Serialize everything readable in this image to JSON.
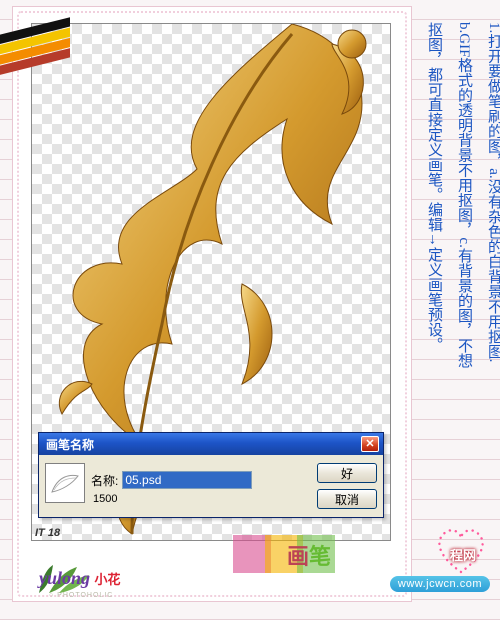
{
  "dialog": {
    "title": "画笔名称",
    "name_label": "名称:",
    "name_value": "05.psd",
    "size_value": "1500",
    "ok_label": "好",
    "cancel_label": "取消"
  },
  "instructions": {
    "line_right": "1.打开要做笔刷的图，a.没有杂色的白背景不用抠图.",
    "line_mid": "b.GIF格式的透明背景不用抠图，c.有背景的图，不想",
    "line_left": "抠图，都可直接定义画笔。编辑→定义画笔预设。"
  },
  "footer": {
    "tag": "IT 18",
    "signature": "yulong",
    "signature_sub": "小花",
    "big_word_a": "画",
    "big_word_b": "笔",
    "photoholic": "○ PHOTOHOLIC"
  },
  "site": {
    "name": "程网",
    "url": "www.jcwcn.com"
  }
}
